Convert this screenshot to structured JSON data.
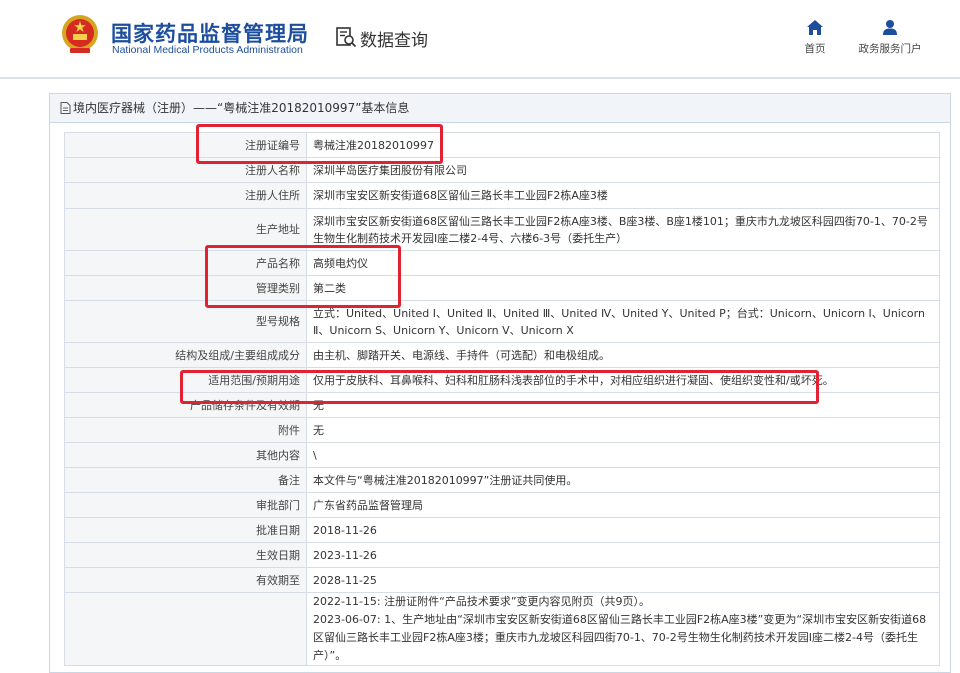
{
  "header": {
    "org_cn": "国家药品监督管理局",
    "org_en": "National Medical Products Administration",
    "query_label": "数据查询",
    "nav": {
      "home": "首页",
      "portal": "政务服务门户"
    }
  },
  "breadcrumb": "境内医疗器械（注册）——“粤械注准20182010997”基本信息",
  "rows": [
    {
      "label": "注册证编号",
      "value": "粤械注准20182010997"
    },
    {
      "label": "注册人名称",
      "value": "深圳半岛医疗集团股份有限公司"
    },
    {
      "label": "注册人住所",
      "value": "深圳市宝安区新安街道68区留仙三路长丰工业园F2栋A座3楼"
    },
    {
      "label": "生产地址",
      "value": "深圳市宝安区新安街道68区留仙三路长丰工业园F2栋A座3楼、B座3楼、B座1楼101；重庆市九龙坡区科园四街70-1、70-2号生物生化制药技术开发园I座二楼2-4号、六楼6-3号（委托生产）"
    },
    {
      "label": "产品名称",
      "value": "高频电灼仪"
    },
    {
      "label": "管理类别",
      "value": "第二类"
    },
    {
      "label": "型号规格",
      "value": "立式：United、United Ⅰ、United Ⅱ、United Ⅲ、United Ⅳ、United Y、United P；台式：Unicorn、Unicorn Ⅰ、Unicorn Ⅱ、Unicorn S、Unicorn Y、Unicorn Ⅴ、Unicorn X"
    },
    {
      "label": "结构及组成/主要组成成分",
      "value": "由主机、脚踏开关、电源线、手持件（可选配）和电极组成。"
    },
    {
      "label": "适用范围/预期用途",
      "value": "仅用于皮肤科、耳鼻喉科、妇科和肛肠科浅表部位的手术中，对相应组织进行凝固、使组织变性和/或坏死。"
    },
    {
      "label": "产品储存条件及有效期",
      "value": "无"
    },
    {
      "label": "附件",
      "value": "无"
    },
    {
      "label": "其他内容",
      "value": "\\"
    },
    {
      "label": "备注",
      "value": "本文件与“粤械注准20182010997”注册证共同使用。"
    },
    {
      "label": "审批部门",
      "value": "广东省药品监督管理局"
    },
    {
      "label": "批准日期",
      "value": "2018-11-26"
    },
    {
      "label": "生效日期",
      "value": "2023-11-26"
    },
    {
      "label": "有效期至",
      "value": "2028-11-25"
    }
  ],
  "change_log": [
    "2022-11-15: 注册证附件“产品技术要求”变更内容见附页（共9页）。",
    "2023-06-07: 1、生产地址由“深圳市宝安区新安街道68区留仙三路长丰工业园F2栋A座3楼”变更为“深圳市宝安区新安街道68区留仙三路长丰工业园F2栋A座3楼；重庆市九龙坡区科园四街70-1、70-2号生物生化制药技术开发园I座二楼2-4号（委托生产）”。"
  ],
  "colors": {
    "brand_blue": "#1d4e9e",
    "highlight_red": "#e02233"
  }
}
